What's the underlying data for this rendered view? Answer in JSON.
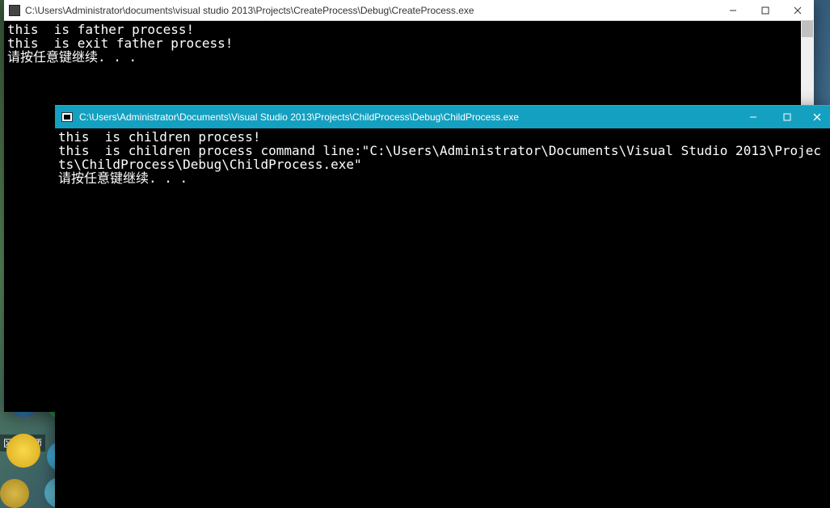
{
  "desktop": {
    "label": "区动大师"
  },
  "window_back": {
    "title": "C:\\Users\\Administrator\\documents\\visual studio 2013\\Projects\\CreateProcess\\Debug\\CreateProcess.exe",
    "lines": {
      "l1": "this  is father process!",
      "l2": "this  is exit father process!",
      "l3": "请按任意键继续. . ."
    }
  },
  "window_front": {
    "title": "C:\\Users\\Administrator\\Documents\\Visual Studio 2013\\Projects\\ChildProcess\\Debug\\ChildProcess.exe",
    "lines": {
      "l1": "this  is children process!",
      "l2": "this  is children process command line:\"C:\\Users\\Administrator\\Documents\\Visual Studio 2013\\Projects\\ChildProcess\\Debug\\ChildProcess.exe\"",
      "l3": "请按任意键继续. . ."
    }
  }
}
